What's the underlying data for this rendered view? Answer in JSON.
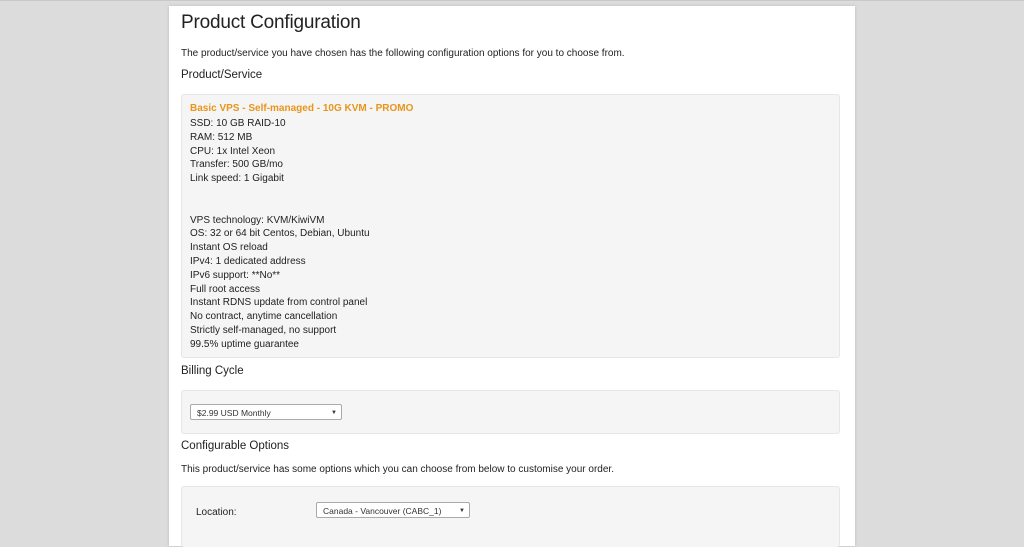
{
  "page_title": "Product Configuration",
  "intro_text": "The product/service you have chosen has the following configuration options for you to choose from.",
  "product_section": {
    "heading": "Product/Service",
    "product_name": "Basic VPS - Self-managed - 10G KVM - PROMO",
    "specs_group1": [
      "SSD: 10 GB RAID-10",
      "RAM: 512 MB",
      "CPU: 1x Intel Xeon",
      "Transfer: 500 GB/mo",
      "Link speed: 1 Gigabit"
    ],
    "specs_group2": [
      "VPS technology: KVM/KiwiVM",
      "OS: 32 or 64 bit Centos, Debian, Ubuntu",
      "Instant OS reload",
      "IPv4: 1 dedicated address",
      "IPv6 support: **No**",
      "Full root access",
      "Instant RDNS update from control panel",
      "No contract, anytime cancellation",
      "Strictly self-managed, no support",
      "99.5% uptime guarantee"
    ],
    "accent_color": "#e8951a"
  },
  "billing_section": {
    "heading": "Billing Cycle",
    "selected": "$2.99 USD Monthly"
  },
  "config_section": {
    "heading": "Configurable Options",
    "description": "This product/service has some options which you can choose from below to customise your order.",
    "location_label": "Location:",
    "location_selected": "Canada - Vancouver (CABC_1)"
  }
}
